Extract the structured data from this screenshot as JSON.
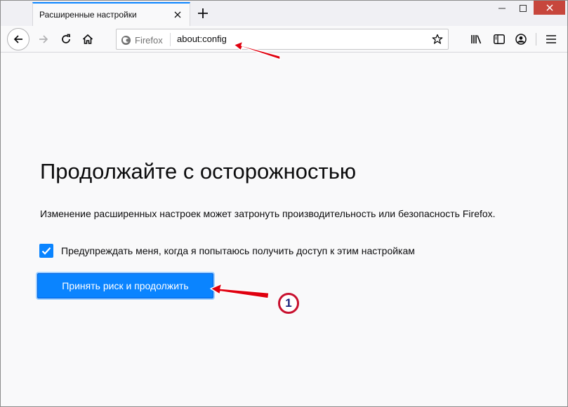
{
  "tab": {
    "title": "Расширенные настройки"
  },
  "urlbar": {
    "identity_label": "Firefox",
    "url": "about:config"
  },
  "page": {
    "heading": "Продолжайте с осторожностью",
    "description": "Изменение расширенных настроек может затронуть производительность или безопасность Firefox.",
    "warn_checkbox_label": "Предупреждать меня, когда я попытаюсь получить доступ к этим настройкам",
    "warn_checked": true,
    "accept_button": "Принять риск и продолжить"
  },
  "annotation": {
    "step_number": "1"
  },
  "colors": {
    "accent": "#0a84ff",
    "annotation_red": "#e0000f",
    "tab_highlight": "#0a84ff"
  },
  "icons": [
    "close-icon",
    "plus-icon",
    "minimize-icon",
    "maximize-icon",
    "back-icon",
    "forward-icon",
    "reload-icon",
    "home-icon",
    "firefox-icon",
    "star-icon",
    "library-icon",
    "sidebar-icon",
    "account-icon",
    "menu-icon",
    "checkmark-icon",
    "arrow-annotation-icon"
  ]
}
